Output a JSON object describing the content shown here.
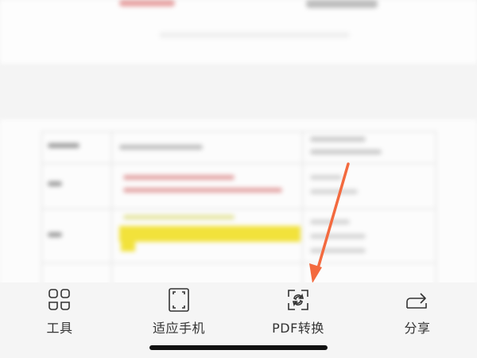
{
  "toolbar": {
    "items": [
      {
        "label": "工具",
        "icon": "grid-tools-icon"
      },
      {
        "label": "适应手机",
        "icon": "fit-screen-icon"
      },
      {
        "label": "PDF转换",
        "icon": "pdf-convert-icon"
      },
      {
        "label": "分享",
        "icon": "share-icon"
      }
    ]
  },
  "colors": {
    "arrow": "#f36a3f",
    "highlight": "#f5e43a",
    "red_text": "#e58a8a",
    "icon_stroke": "#333333"
  }
}
